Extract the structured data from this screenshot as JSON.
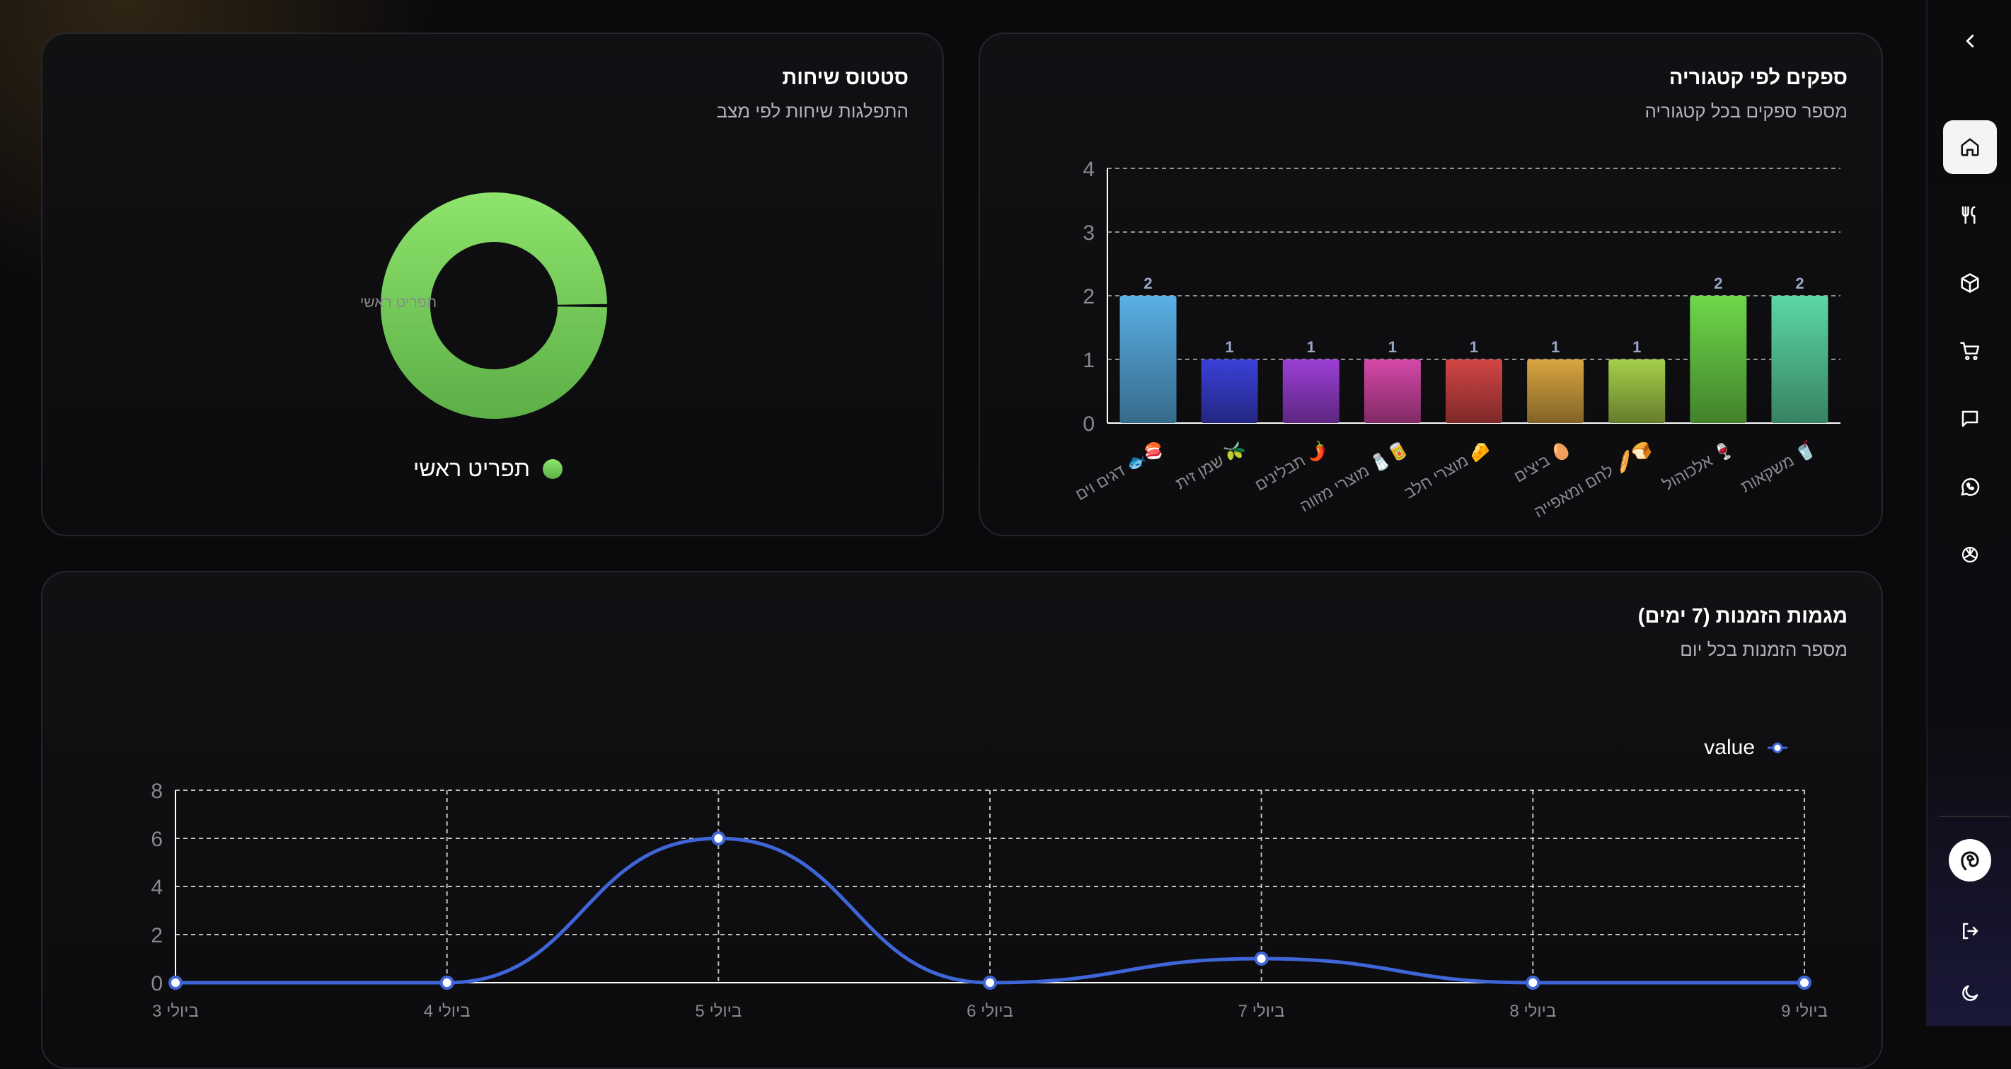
{
  "status_card": {
    "title": "סטטוס שיחות",
    "subtitle": "התפלגות שיחות לפי מצב",
    "legend": [
      "תפריט ראשי"
    ],
    "colors": [
      "#7cd460"
    ]
  },
  "suppliers_card": {
    "title": "ספקים לפי קטגוריה",
    "subtitle": "מספר ספקים בכל קטגוריה"
  },
  "trends_card": {
    "title": "מגמות הזמנות (7 ימים)",
    "subtitle": "מספר הזמנות בכל יום",
    "legend": "value",
    "color": "#3f66d8"
  },
  "chart_data": [
    {
      "type": "pie",
      "categories": [
        "תפריט ראשי"
      ],
      "values": [
        100
      ],
      "slice_label": "תפריט ראשי",
      "donut": true
    },
    {
      "type": "bar",
      "categories": [
        "דגים וים 🐟🍣",
        "שמן זית 🫒",
        "תבלינים 🌶️",
        "מוצרי מזווה 🧂🥫",
        "מוצרי חלב 🧀",
        "ביצים 🥚",
        "לחם ומאפייה 🥖🍞",
        "אלכוהול 🍷",
        "משקאות 🥤"
      ],
      "values": [
        2,
        1,
        1,
        1,
        1,
        1,
        1,
        2,
        2
      ],
      "colors": [
        "#5ab0e6",
        "#3a40d8",
        "#9b3fd6",
        "#d548a8",
        "#d24545",
        "#d8a540",
        "#a6d04a",
        "#6ed84a",
        "#5cd8a4"
      ],
      "y_ticks": [
        "0",
        "1",
        "2",
        "3",
        "4"
      ],
      "ylim": [
        0,
        4
      ],
      "grid": true
    },
    {
      "type": "line",
      "series": [
        {
          "name": "value",
          "values": [
            0,
            0,
            6,
            0,
            1,
            0,
            0
          ]
        }
      ],
      "x": [
        "3 ביולי",
        "4 ביולי",
        "5 ביולי",
        "6 ביולי",
        "7 ביולי",
        "8 ביולי",
        "9 ביולי"
      ],
      "y_ticks": [
        "0",
        "2",
        "4",
        "6",
        "8"
      ],
      "ylim": [
        0,
        8
      ],
      "grid": true,
      "legend": "top-right"
    }
  ],
  "sidebar": {
    "items": [
      {
        "icon": "chevron-left-icon"
      },
      {
        "icon": "home-icon",
        "active": true
      },
      {
        "icon": "utensils-icon"
      },
      {
        "icon": "box-icon"
      },
      {
        "icon": "cart-icon"
      },
      {
        "icon": "message-icon"
      },
      {
        "icon": "whatsapp-icon"
      },
      {
        "icon": "openai-icon"
      },
      {
        "icon": "avatar-icon"
      },
      {
        "icon": "logout-icon"
      },
      {
        "icon": "moon-icon"
      }
    ]
  }
}
